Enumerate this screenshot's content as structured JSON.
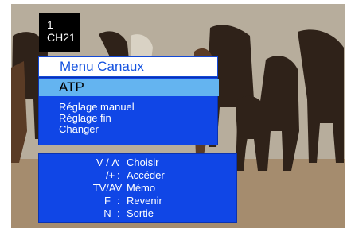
{
  "channel": {
    "number": "1",
    "name": "CH21"
  },
  "menu": {
    "title": "Menu Canaux",
    "selected_item": "ATP",
    "items": [
      "Réglage manuel",
      "Réglage fin",
      "Changer"
    ]
  },
  "help": [
    {
      "key": "V / Λ",
      "separator": ":",
      "action": "Choisir"
    },
    {
      "key": "–/+",
      "separator": ":",
      "action": "Accéder"
    },
    {
      "key": "TV/AV",
      "separator": ":",
      "action": "Mémo"
    },
    {
      "key": "F",
      "separator": ":",
      "action": "Revenir"
    },
    {
      "key": "N",
      "separator": ":",
      "action": "Sortie"
    }
  ],
  "colors": {
    "menu_blue": "#1046e6",
    "highlight": "#64b4f0",
    "title_text": "#1452e0"
  }
}
